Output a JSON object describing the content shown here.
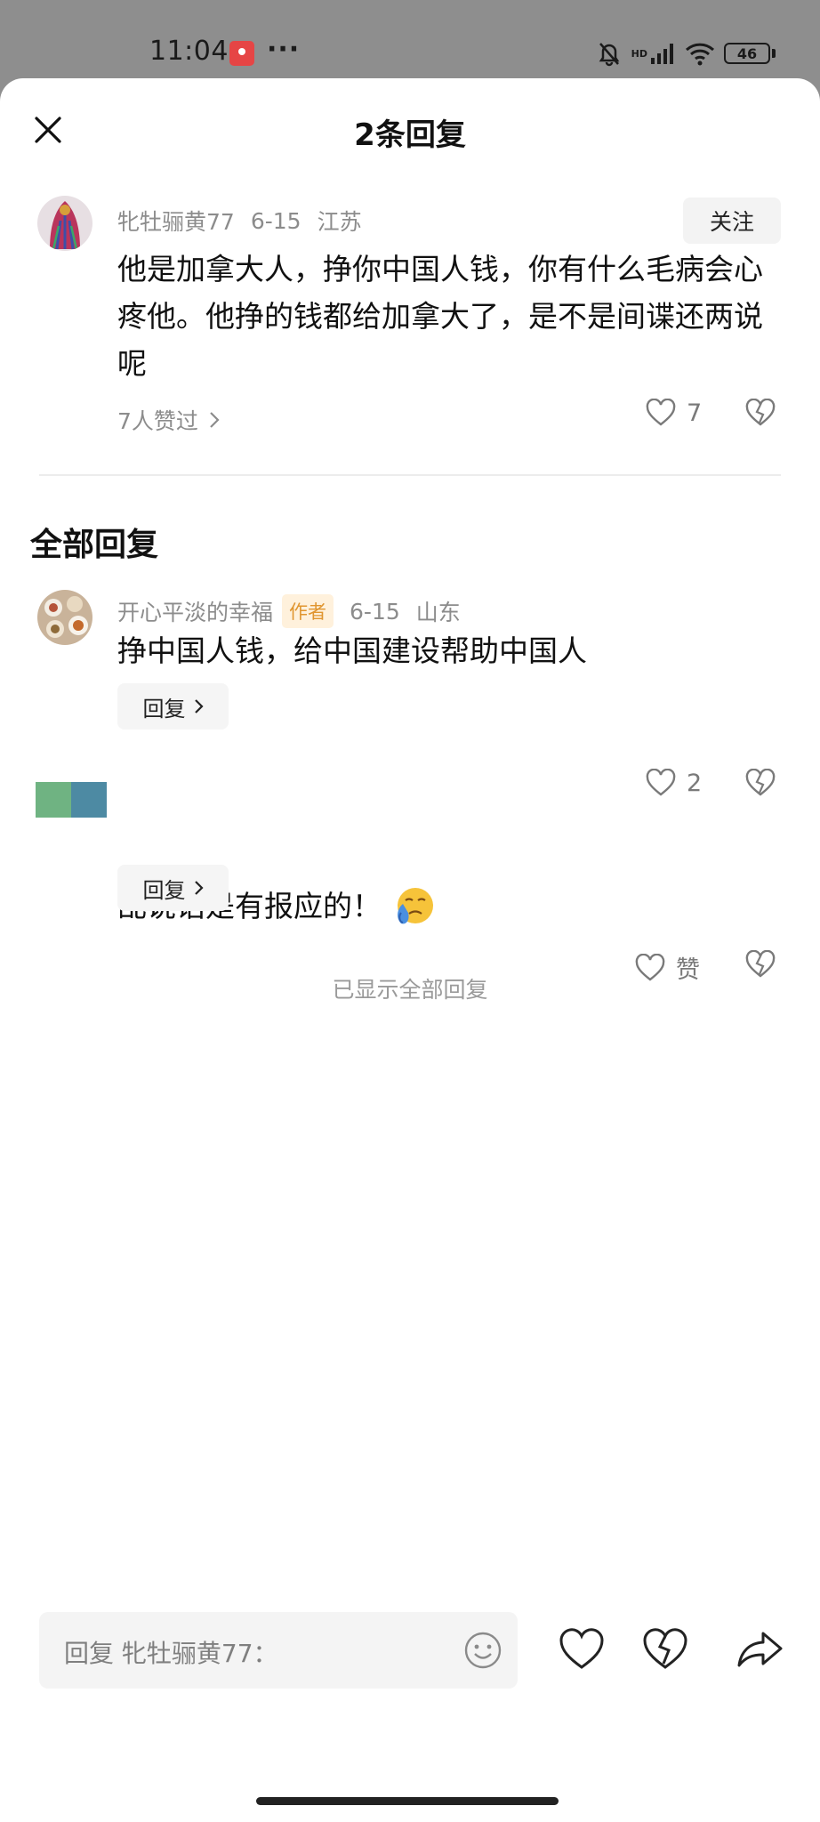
{
  "status_bar": {
    "time": "11:04",
    "more": "···",
    "network": "HD",
    "battery": "46"
  },
  "sheet": {
    "title": "2条回复"
  },
  "main_comment": {
    "username": "牝牡骊黄77",
    "date": "6-15",
    "location": "江苏",
    "follow_label": "关注",
    "text": "他是加拿大人，挣你中国人钱，你有什么毛病会心疼他。他挣的钱都给加拿大了，是不是间谍还两说呢",
    "likers_text": "7人赞过",
    "like_count": "7"
  },
  "replies_section": {
    "title": "全部回复",
    "replies": [
      {
        "username": "开心平淡的幸福",
        "badge": "作者",
        "date": "6-15",
        "location": "山东",
        "text": "挣中国人钱，给中国建设帮助中国人",
        "reply_label": "回复",
        "like_count": "2"
      },
      {
        "text": "乱说话是有报应的！",
        "reply_label": "回复",
        "like_label": "赞"
      }
    ],
    "end_note": "已显示全部回复"
  },
  "bottom_bar": {
    "input_placeholder": "回复 牝牡骊黄77："
  }
}
